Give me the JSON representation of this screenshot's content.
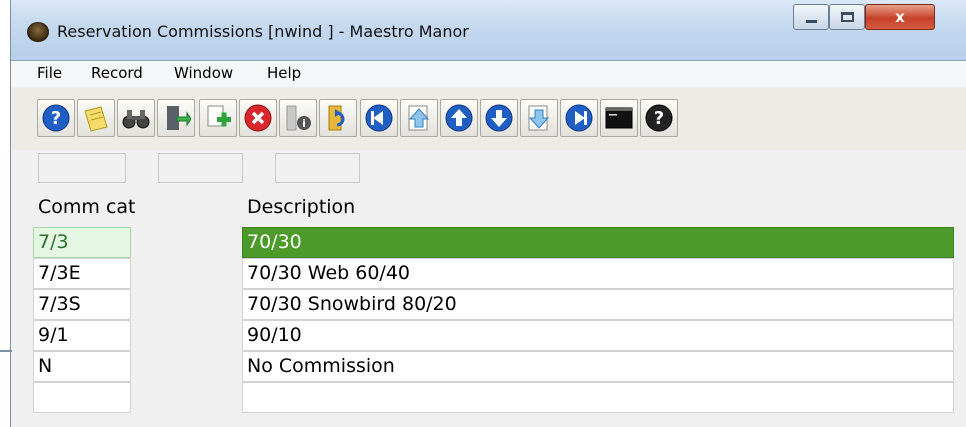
{
  "window": {
    "title": "Reservation Commissions [nwind   ] - Maestro Manor",
    "controls": {
      "minimize": "–",
      "maximize": "□",
      "close": "x"
    }
  },
  "menu": [
    "File",
    "Record",
    "Window",
    "Help"
  ],
  "toolbar": {
    "buttons": [
      "help-icon",
      "notes-icon",
      "binoculars-icon",
      "exit-door-icon",
      "new-record-icon",
      "delete-record-icon",
      "info-icon",
      "refresh-icon",
      "first-record-icon",
      "previous-page-icon",
      "previous-record-icon",
      "next-record-icon",
      "next-page-icon",
      "last-record-icon",
      "console-icon",
      "context-help-icon"
    ]
  },
  "columns": {
    "code": "Comm cat",
    "description": "Description"
  },
  "rows": [
    {
      "code": "7/3",
      "description": "70/30"
    },
    {
      "code": "7/3E",
      "description": "70/30 Web 60/40"
    },
    {
      "code": "7/3S",
      "description": "70/30 Snowbird 80/20"
    },
    {
      "code": "9/1",
      "description": "90/10"
    },
    {
      "code": "N",
      "description": "No Commission"
    },
    {
      "code": "",
      "description": ""
    }
  ],
  "selected_row": 0,
  "colors": {
    "selection": "#4c9a2a",
    "selection_code_bg": "#e3f7e3"
  }
}
